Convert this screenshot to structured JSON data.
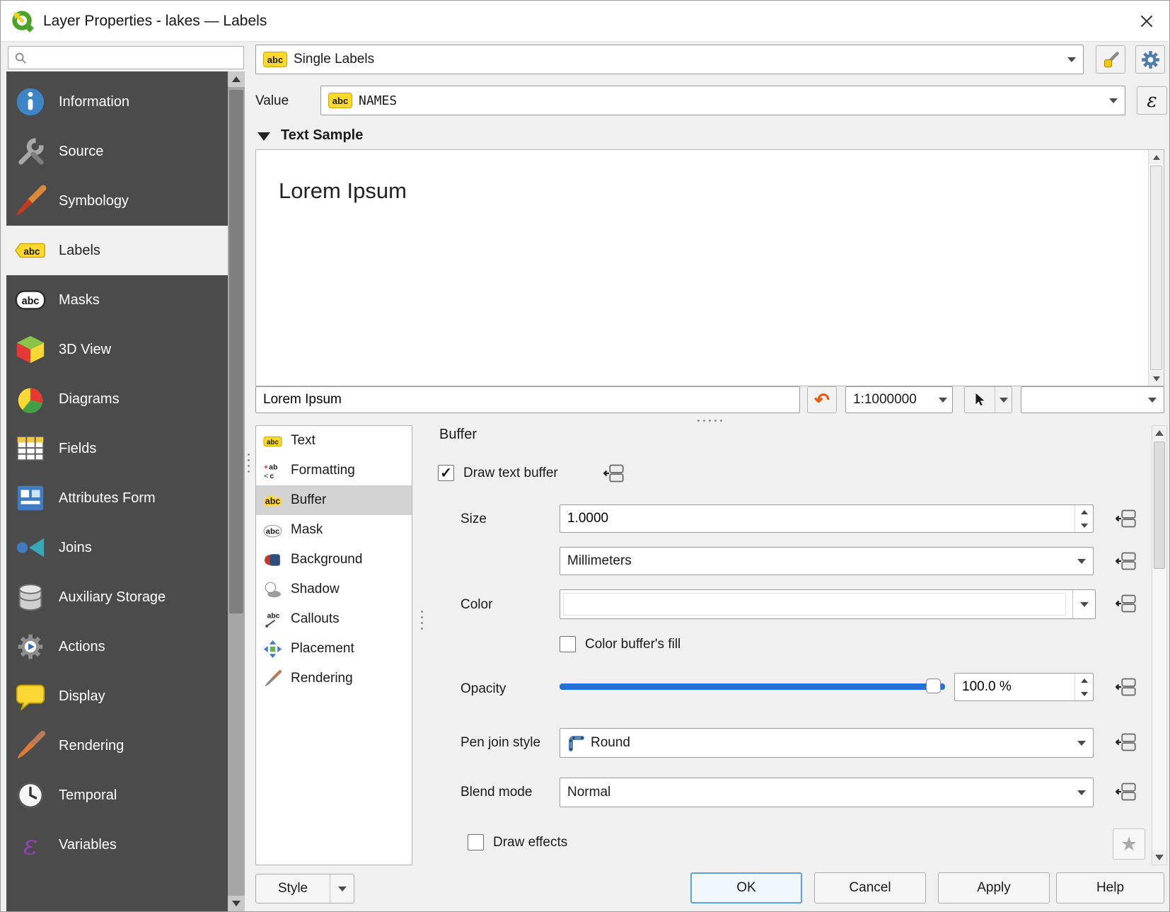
{
  "window": {
    "title": "Layer Properties - lakes — Labels"
  },
  "icons": {
    "check": "✓",
    "undo": "↶",
    "star": "★",
    "expression": "ε"
  },
  "colors": {
    "accent_blue": "#2270d8",
    "sidebar_bg": "#4b4b4b",
    "label_yellow": "#ffd92e"
  },
  "sidebar": {
    "search_value": "",
    "items": [
      {
        "label": "Information",
        "icon": "information-icon",
        "selected": false
      },
      {
        "label": "Source",
        "icon": "source-icon",
        "selected": false
      },
      {
        "label": "Symbology",
        "icon": "symbology-icon",
        "selected": false
      },
      {
        "label": "Labels",
        "icon": "labels-icon",
        "selected": true
      },
      {
        "label": "Masks",
        "icon": "masks-icon",
        "selected": false
      },
      {
        "label": "3D View",
        "icon": "cube-3d-icon",
        "selected": false
      },
      {
        "label": "Diagrams",
        "icon": "pie-chart-icon",
        "selected": false
      },
      {
        "label": "Fields",
        "icon": "table-icon",
        "selected": false
      },
      {
        "label": "Attributes Form",
        "icon": "form-icon",
        "selected": false
      },
      {
        "label": "Joins",
        "icon": "join-icon",
        "selected": false
      },
      {
        "label": "Auxiliary Storage",
        "icon": "database-icon",
        "selected": false
      },
      {
        "label": "Actions",
        "icon": "gear-play-icon",
        "selected": false
      },
      {
        "label": "Display",
        "icon": "speech-bubble-icon",
        "selected": false
      },
      {
        "label": "Rendering",
        "icon": "paintbrush-icon",
        "selected": false
      },
      {
        "label": "Temporal",
        "icon": "clock-icon",
        "selected": false
      },
      {
        "label": "Variables",
        "icon": "epsilon-icon",
        "selected": false
      }
    ]
  },
  "header": {
    "mode": "Single Labels",
    "value_label": "Value",
    "value_field": "NAMES"
  },
  "text_sample": {
    "section_title": "Text Sample",
    "preview_text": "Lorem Ipsum",
    "input_value": "Lorem Ipsum",
    "scale": "1:1000000"
  },
  "tabs": [
    {
      "label": "Text",
      "selected": false
    },
    {
      "label": "Formatting",
      "selected": false
    },
    {
      "label": "Buffer",
      "selected": true
    },
    {
      "label": "Mask",
      "selected": false
    },
    {
      "label": "Background",
      "selected": false
    },
    {
      "label": "Shadow",
      "selected": false
    },
    {
      "label": "Callouts",
      "selected": false
    },
    {
      "label": "Placement",
      "selected": false
    },
    {
      "label": "Rendering",
      "selected": false
    }
  ],
  "buffer": {
    "title": "Buffer",
    "draw_text_buffer_label": "Draw text buffer",
    "draw_text_buffer_checked": true,
    "size_label": "Size",
    "size_value": "1.0000",
    "units_value": "Millimeters",
    "color_label": "Color",
    "color_value": "#ffffff",
    "color_fill_label": "Color buffer's fill",
    "color_fill_checked": false,
    "opacity_label": "Opacity",
    "opacity_percent": 100,
    "opacity_value": "100.0 %",
    "pen_join_label": "Pen join style",
    "pen_join_value": "Round",
    "blend_label": "Blend mode",
    "blend_value": "Normal",
    "draw_effects_label": "Draw effects",
    "draw_effects_checked": false
  },
  "footer": {
    "style": "Style",
    "ok": "OK",
    "cancel": "Cancel",
    "apply": "Apply",
    "help": "Help"
  }
}
